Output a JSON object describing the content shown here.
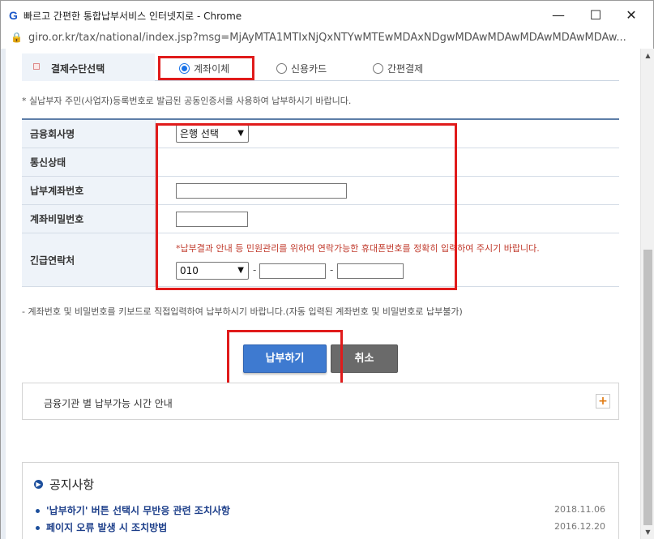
{
  "window": {
    "title": "빠르고 간편한 통합납부서비스 인터넷지로 - Chrome",
    "url": "giro.or.kr/tax/national/index.jsp?msg=MjAyMTA1MTIxNjQxNTYwMTEwMDAxNDgwMDAwMDAwMDAwMDAwMDAw..."
  },
  "payment_method": {
    "label": "결제수단선택",
    "options": [
      "계좌이체",
      "신용카드",
      "간편결제"
    ],
    "selected": "계좌이체"
  },
  "notice_cert": "* 실납부자 주민(사업자)등록번호로 발급된 공동인증서를 사용하여 납부하시기 바랍니다.",
  "form": {
    "bank_label": "금융회사명",
    "bank_select": "은행 선택",
    "status_label": "통신상태",
    "account_label": "납부계좌번호",
    "password_label": "계좌비밀번호",
    "contact_label": "긴급연락처",
    "contact_warning": "*납부결과 안내 등 민원관리를 위하여 연락가능한 휴대폰번호를 정확히 입력하여 주시기 바랍니다.",
    "phone_prefix": "010",
    "dash": "-"
  },
  "notice_keyboard": "- 계좌번호 및 비밀번호를 키보드로 직접입력하여 납부하시기 바랍니다.(자동 입력된 계좌번호 및 비밀번호로 납부불가)",
  "buttons": {
    "pay": "납부하기",
    "cancel": "취소"
  },
  "guide": {
    "label": "금융기관 별 납부가능 시간 안내",
    "expand": "+"
  },
  "notices": {
    "title": "공지사항",
    "items": [
      {
        "text": "'납부하기' 버튼 선택시 무반응 관련 조치사항",
        "date": "2018.11.06"
      },
      {
        "text": "페이지 오류 발생 시 조치방법",
        "date": "2016.12.20"
      }
    ]
  }
}
